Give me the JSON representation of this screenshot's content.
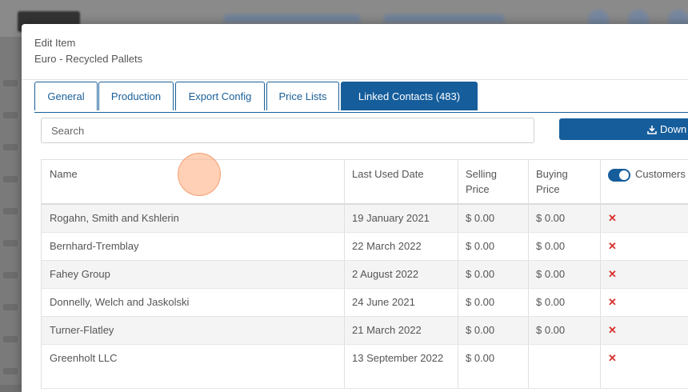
{
  "modal": {
    "title": "Edit Item",
    "subtitle": "Euro - Recycled Pallets"
  },
  "tabs": [
    {
      "label": "General"
    },
    {
      "label": "Production"
    },
    {
      "label": "Export Config"
    },
    {
      "label": "Price Lists"
    },
    {
      "label": "Linked Contacts (483)",
      "active": true
    }
  ],
  "search": {
    "placeholder": "Search",
    "value": ""
  },
  "download_button": {
    "label": "Down",
    "icon": "download-icon"
  },
  "table": {
    "headers": {
      "name": "Name",
      "last_used_date": "Last Used Date",
      "selling_price": "Selling Price",
      "buying_price": "Buying Price",
      "customers": "Customers"
    },
    "customers_toggle_on": true,
    "rows": [
      {
        "name": "Rogahn, Smith and Kshlerin",
        "date": "19 January 2021",
        "selling": "$ 0.00",
        "buying": "$ 0.00"
      },
      {
        "name": "Bernhard-Tremblay",
        "date": "22 March 2022",
        "selling": "$ 0.00",
        "buying": "$ 0.00"
      },
      {
        "name": "Fahey Group",
        "date": "2 August 2022",
        "selling": "$ 0.00",
        "buying": "$ 0.00"
      },
      {
        "name": "Donnelly, Welch and Jaskolski",
        "date": "24 June 2021",
        "selling": "$ 0.00",
        "buying": "$ 0.00"
      },
      {
        "name": "Turner-Flatley",
        "date": "21 March 2022",
        "selling": "$ 0.00",
        "buying": "$ 0.00"
      },
      {
        "name": "Greenholt LLC",
        "date": "13 September 2022",
        "selling": "$ 0.00",
        "buying": ""
      }
    ]
  },
  "colors": {
    "accent": "#155d9b",
    "remove": "#d9302f"
  }
}
